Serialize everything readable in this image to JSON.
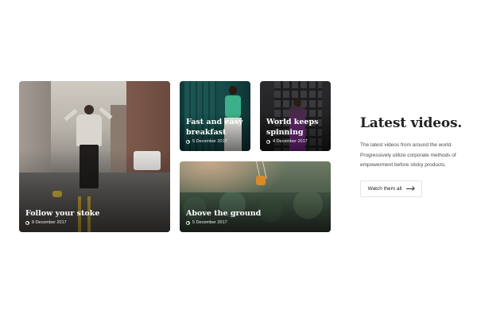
{
  "section": {
    "heading": "Latest videos.",
    "description": "The latest videos from around the world. Progressively utilize corporate methods of empowerment before sticky products.",
    "cta_label": "Watch them all",
    "cta_icon": "arrow-right-icon"
  },
  "cards": [
    {
      "title": "Follow your stoke",
      "date": "8 December 2017",
      "date_icon": "clock-icon"
    },
    {
      "title": "Fast and easy breakfast",
      "date": "5 December 2017",
      "date_icon": "clock-icon"
    },
    {
      "title": "World keeps spinning",
      "date": "4 December 2017",
      "date_icon": "clock-icon"
    },
    {
      "title": "Above the ground",
      "date": "5 December 2017",
      "date_icon": "clock-icon"
    }
  ],
  "colors": {
    "heading": "#222222",
    "text": "#4a4a4a",
    "card_text": "#ffffff",
    "button_border": "#e3e3e3"
  }
}
